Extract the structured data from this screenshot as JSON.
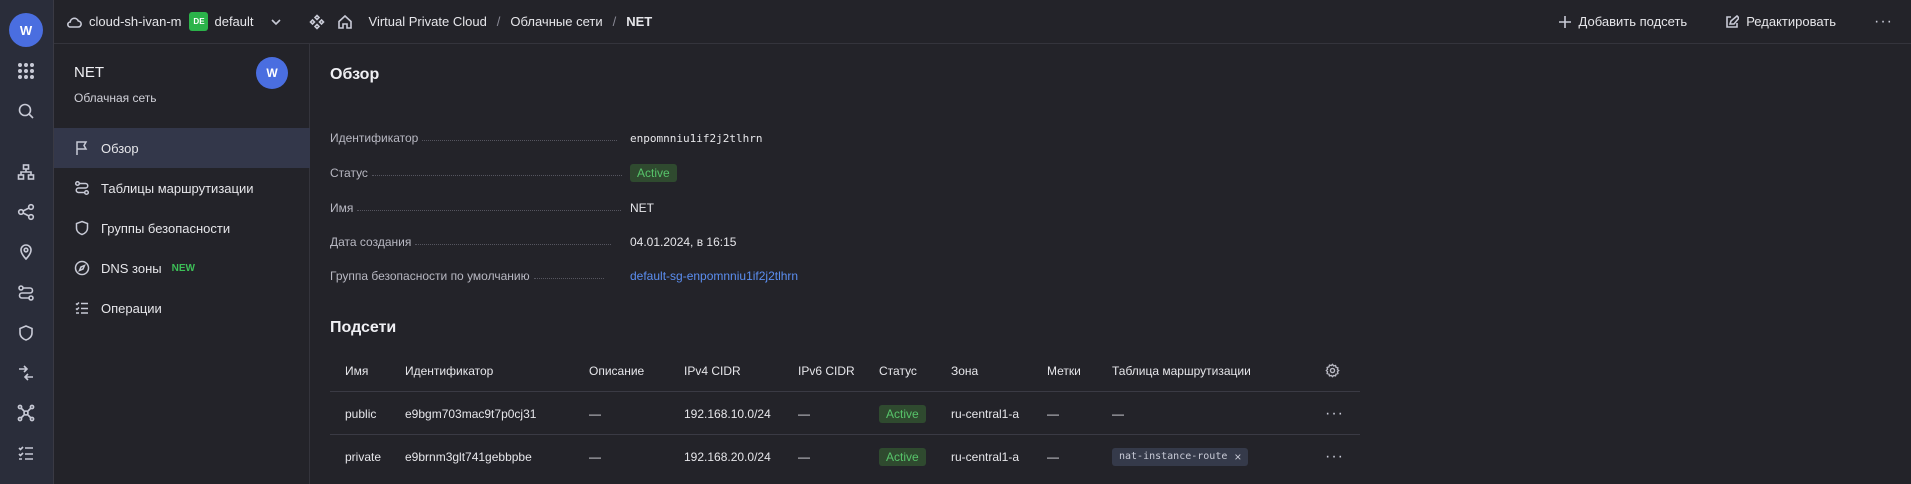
{
  "rail": {
    "logo": "W",
    "icons": [
      "apps-grid-icon",
      "search-icon",
      "network-topology-icon",
      "share-icon",
      "location-pin-icon",
      "routes-icon",
      "shield-icon",
      "arrows-in-icon",
      "nodes-icon",
      "checklist-icon"
    ]
  },
  "header": {
    "cloud_name": "cloud-sh-ivan-m",
    "env_badge": "DE",
    "folder": "default",
    "breadcrumbs": [
      "Virtual Private Cloud",
      "Облачные сети",
      "NET"
    ],
    "breadcrumb_sep": "/",
    "add_subnet_label": "Добавить подсеть",
    "edit_label": "Редактировать",
    "more_label": "···"
  },
  "sidebar": {
    "title": "NET",
    "subtitle": "Облачная сеть",
    "avatar": "W",
    "items": [
      {
        "label": "Обзор",
        "icon": "flag-icon",
        "active": true
      },
      {
        "label": "Таблицы маршрутизации",
        "icon": "route-icon"
      },
      {
        "label": "Группы безопасности",
        "icon": "shield-icon"
      },
      {
        "label": "DNS зоны",
        "icon": "compass-icon",
        "badge": "NEW"
      },
      {
        "label": "Операции",
        "icon": "list-icon"
      }
    ]
  },
  "overview": {
    "title": "Обзор",
    "id_label": "Идентификатор",
    "id_value": "enpomnniu1if2j2tlhrn",
    "status_label": "Статус",
    "status_value": "Active",
    "name_label": "Имя",
    "name_value": "NET",
    "created_label": "Дата создания",
    "created_value": "04.01.2024, в 16:15",
    "sg_label": "Группа безопасности по умолчанию",
    "sg_value": "default-sg-enpomnniu1if2j2tlhrn"
  },
  "subnets": {
    "title": "Подсети",
    "columns": [
      "Имя",
      "Идентификатор",
      "Описание",
      "IPv4 CIDR",
      "IPv6 CIDR",
      "Статус",
      "Зона",
      "Метки",
      "Таблица маршрутизации"
    ],
    "rows": [
      {
        "name": "public",
        "id": "e9bgm703mac9t7p0cj31",
        "desc": "—",
        "ipv4": "192.168.10.0/24",
        "ipv6": "—",
        "status": "Active",
        "zone": "ru-central1-a",
        "labels": "—",
        "route": "—",
        "route_is_tag": false
      },
      {
        "name": "private",
        "id": "e9brnm3glt741gebbpbe",
        "desc": "—",
        "ipv4": "192.168.20.0/24",
        "ipv6": "—",
        "status": "Active",
        "zone": "ru-central1-a",
        "labels": "—",
        "route": "nat-instance-route",
        "route_is_tag": true
      }
    ],
    "row_more": "···",
    "tag_remove": "×"
  }
}
